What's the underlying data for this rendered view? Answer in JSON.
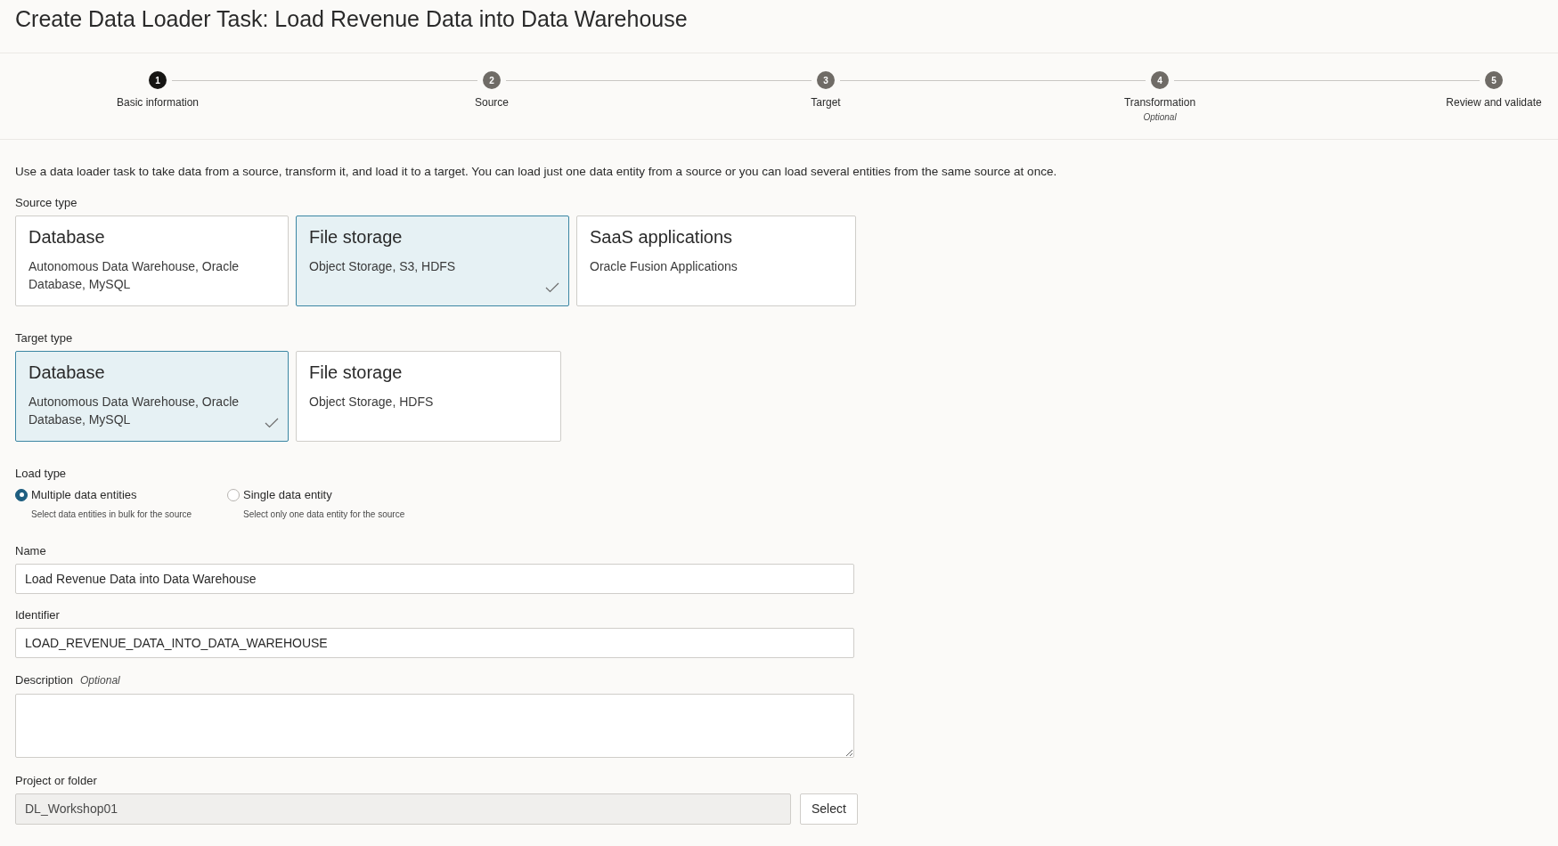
{
  "title": "Create Data Loader Task: Load Revenue Data into Data Warehouse",
  "steps": [
    {
      "number": "1",
      "label": "Basic information",
      "selected": true
    },
    {
      "number": "2",
      "label": "Source",
      "selected": false
    },
    {
      "number": "3",
      "label": "Target",
      "selected": false
    },
    {
      "number": "4",
      "label": "Transformation",
      "sublabel": "Optional",
      "selected": false
    },
    {
      "number": "5",
      "label": "Review and validate",
      "selected": false
    }
  ],
  "intro": "Use a data loader task to take data from a source, transform it, and load it to a target. You can load just one data entity from a source or you can load several entities from the same source at once.",
  "source_type": {
    "label": "Source type",
    "options": [
      {
        "title": "Database",
        "description": "Autonomous Data Warehouse, Oracle Database, MySQL",
        "selected": false
      },
      {
        "title": "File storage",
        "description": "Object Storage, S3, HDFS",
        "selected": true
      },
      {
        "title": "SaaS applications",
        "description": "Oracle Fusion Applications",
        "selected": false
      }
    ]
  },
  "target_type": {
    "label": "Target type",
    "options": [
      {
        "title": "Database",
        "description": "Autonomous Data Warehouse, Oracle Database, MySQL",
        "selected": true
      },
      {
        "title": "File storage",
        "description": "Object Storage, HDFS",
        "selected": false
      }
    ]
  },
  "load_type": {
    "label": "Load type",
    "options": [
      {
        "label": "Multiple data entities",
        "hint": "Select data entities in bulk for the source",
        "selected": true
      },
      {
        "label": "Single data entity",
        "hint": "Select only one data entity for the source",
        "selected": false
      }
    ]
  },
  "name": {
    "label": "Name",
    "value": "Load Revenue Data into Data Warehouse"
  },
  "identifier": {
    "label": "Identifier",
    "value": "LOAD_REVENUE_DATA_INTO_DATA_WAREHOUSE"
  },
  "description": {
    "label": "Description",
    "optional": "Optional"
  },
  "project": {
    "label": "Project or folder",
    "value": "DL_Workshop01",
    "disabled": true,
    "button": "Select"
  }
}
